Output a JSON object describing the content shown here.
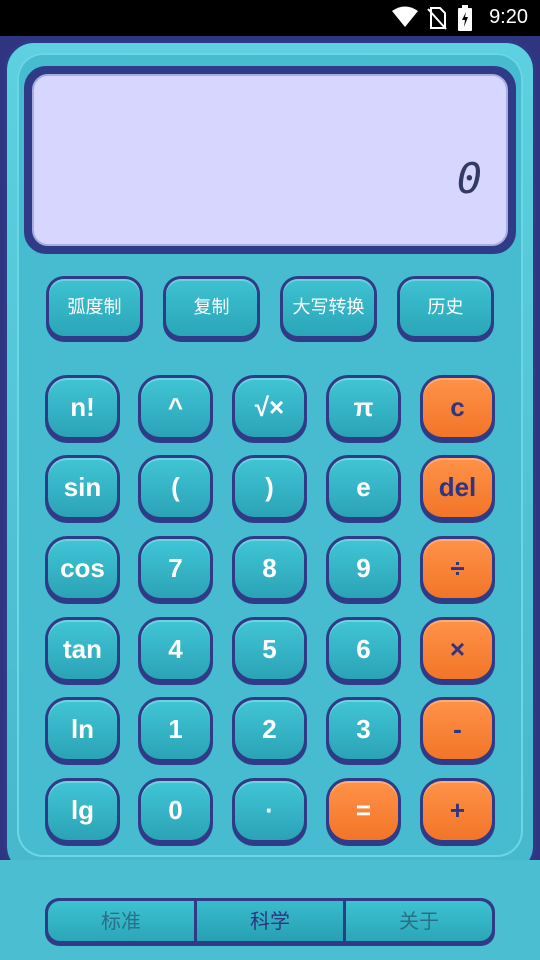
{
  "status_bar": {
    "time": "9:20",
    "icons": [
      "wifi-icon",
      "no-sim-icon",
      "battery-charging-icon"
    ]
  },
  "display": {
    "value": "0"
  },
  "function_buttons": [
    {
      "label": "弧度制"
    },
    {
      "label": "复制"
    },
    {
      "label": "大写转换"
    },
    {
      "label": "历史"
    }
  ],
  "keypad": {
    "rows": [
      [
        "n!",
        "^",
        "√×",
        "π",
        "c"
      ],
      [
        "sin",
        "(",
        ")",
        "e",
        "del"
      ],
      [
        "cos",
        "7",
        "8",
        "9",
        "÷"
      ],
      [
        "tan",
        "4",
        "5",
        "6",
        "×"
      ],
      [
        "ln",
        "1",
        "2",
        "3",
        "-"
      ],
      [
        "lg",
        "0",
        "·",
        "=",
        "+"
      ]
    ]
  },
  "tabs": [
    {
      "label": "标准",
      "active": false
    },
    {
      "label": "科学",
      "active": true
    },
    {
      "label": "关于",
      "active": false
    }
  ],
  "colors": {
    "frame": "#2f3580",
    "key_teal": "#33b1c4",
    "key_orange": "#f27a2d",
    "display_bg": "#d6d6ff"
  }
}
